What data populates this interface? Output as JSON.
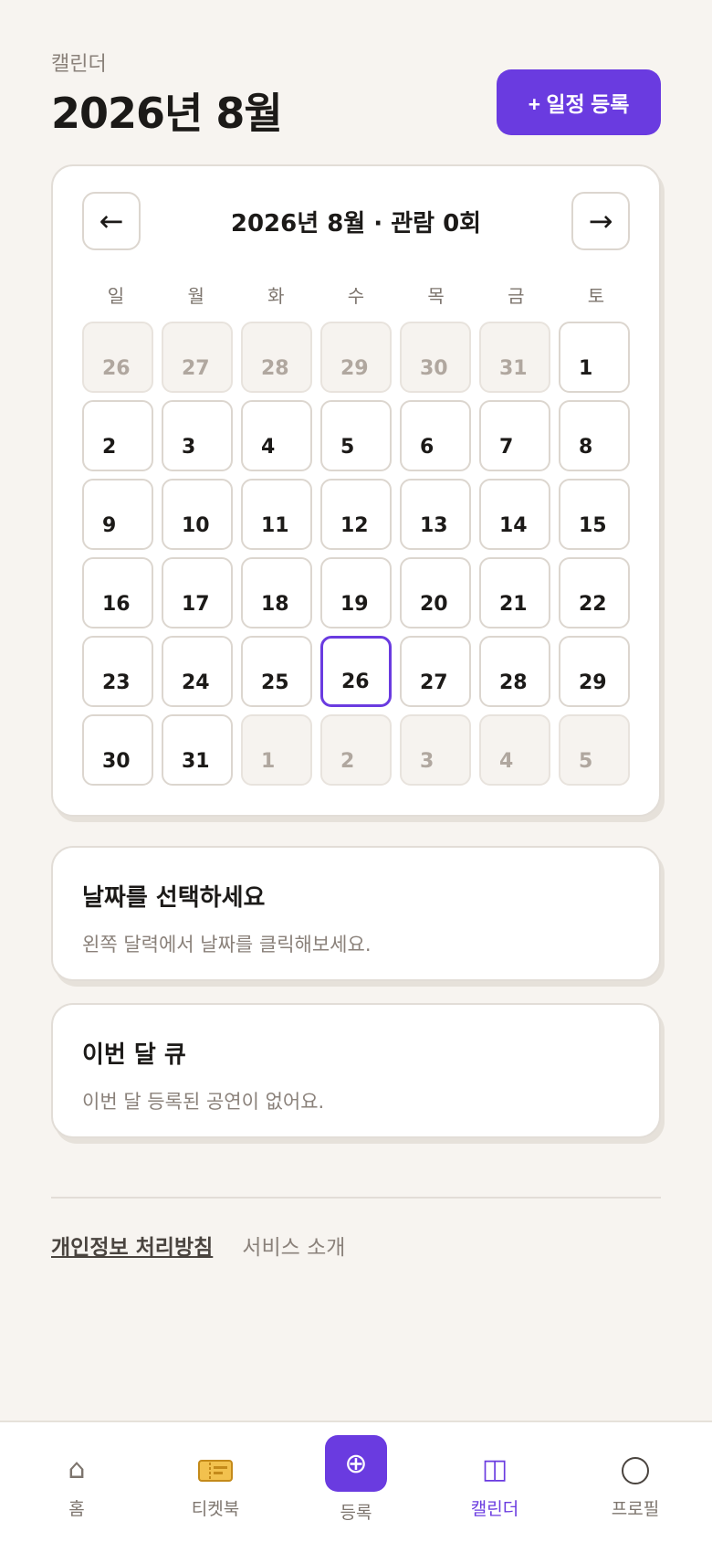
{
  "header": {
    "eyebrow": "캘린더",
    "title": "2026년 8월",
    "add_button": "+ 일정 등록"
  },
  "calendar": {
    "title": "2026년 8월 · 관람 0회",
    "prev": "←",
    "next": "→",
    "weekdays": [
      "일",
      "월",
      "화",
      "수",
      "목",
      "금",
      "토"
    ],
    "weeks": [
      [
        "26",
        "27",
        "28",
        "29",
        "30",
        "31",
        "1"
      ],
      [
        "2",
        "3",
        "4",
        "5",
        "6",
        "7",
        "8"
      ],
      [
        "9",
        "10",
        "11",
        "12",
        "13",
        "14",
        "15"
      ],
      [
        "16",
        "17",
        "18",
        "19",
        "20",
        "21",
        "22"
      ],
      [
        "23",
        "24",
        "25",
        "26",
        "27",
        "28",
        "29"
      ],
      [
        "30",
        "31",
        "1",
        "2",
        "3",
        "4",
        "5"
      ]
    ],
    "selected_date": "26"
  },
  "select_card": {
    "title": "날짜를 선택하세요",
    "body": "왼쪽 달력에서 날짜를 클릭해보세요."
  },
  "queue_card": {
    "title": "이번 달 큐",
    "body": "이번 달 등록된 공연이 없어요."
  },
  "footer": {
    "privacy": "개인정보 처리방침",
    "about": "서비스 소개"
  },
  "tabbar": {
    "home": "홈",
    "ticketbook": "티켓북",
    "register": "등록",
    "calendar": "캘린더",
    "profile": "프로필"
  },
  "colors": {
    "accent": "#6a3be0",
    "background": "#f7f4f0"
  }
}
